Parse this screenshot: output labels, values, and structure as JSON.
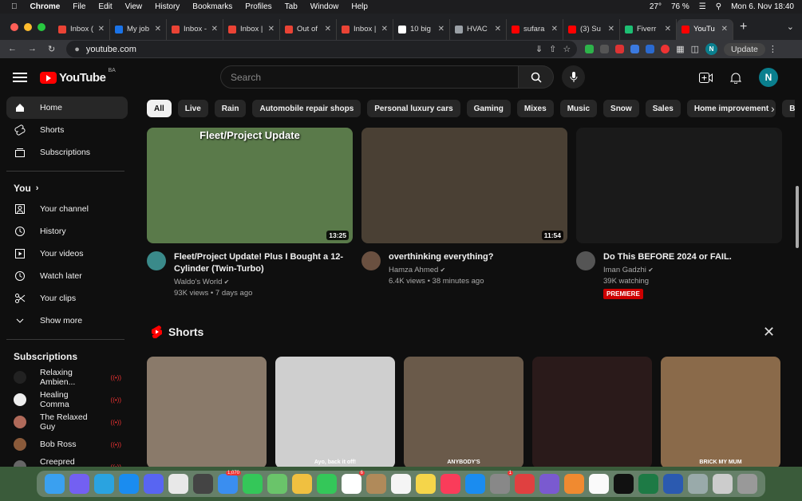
{
  "mac_menubar": {
    "app": "Chrome",
    "menus": [
      "File",
      "Edit",
      "View",
      "History",
      "Bookmarks",
      "Profiles",
      "Tab",
      "Window",
      "Help"
    ],
    "battery": "76 %",
    "temp": "27°",
    "clock": "Mon 6. Nov  18:40"
  },
  "tabs": [
    {
      "title": "Inbox (",
      "color": "#ea4335"
    },
    {
      "title": "My job",
      "color": "#1a73e8"
    },
    {
      "title": "Inbox -",
      "color": "#ea4335"
    },
    {
      "title": "Inbox |",
      "color": "#ea4335"
    },
    {
      "title": "Out of",
      "color": "#ea4335"
    },
    {
      "title": "Inbox |",
      "color": "#ea4335"
    },
    {
      "title": "10 big",
      "color": "#ffffff"
    },
    {
      "title": "HVAC",
      "color": "#9aa0a6"
    },
    {
      "title": "sufara",
      "color": "#ff0000"
    },
    {
      "title": "(3) Su",
      "color": "#ff0000"
    },
    {
      "title": "Fiverr",
      "color": "#1dbf73"
    },
    {
      "title": "YouTu",
      "color": "#ff0000"
    }
  ],
  "omnibox": {
    "url": "youtube.com"
  },
  "toolbar": {
    "update_label": "Update",
    "profile_initial": "N"
  },
  "youtube": {
    "logo_text": "YouTube",
    "country": "BA",
    "search_placeholder": "Search",
    "avatar_initial": "N"
  },
  "sidebar": {
    "main": [
      {
        "label": "Home",
        "icon": "home-icon",
        "active": true
      },
      {
        "label": "Shorts",
        "icon": "shorts-icon"
      },
      {
        "label": "Subscriptions",
        "icon": "subscriptions-icon"
      }
    ],
    "you_heading": "You",
    "you": [
      {
        "label": "Your channel",
        "icon": "channel-icon"
      },
      {
        "label": "History",
        "icon": "history-icon"
      },
      {
        "label": "Your videos",
        "icon": "videos-icon"
      },
      {
        "label": "Watch later",
        "icon": "watch-later-icon"
      },
      {
        "label": "Your clips",
        "icon": "clips-icon"
      },
      {
        "label": "Show more",
        "icon": "chevron-down-icon"
      }
    ],
    "subs_heading": "Subscriptions",
    "subscriptions": [
      {
        "label": "Relaxing Ambien...",
        "color": "#222"
      },
      {
        "label": "Healing Comma",
        "color": "#eee"
      },
      {
        "label": "The Relaxed Guy",
        "color": "#b06a5a"
      },
      {
        "label": "Bob Ross",
        "color": "#8a5a3a"
      },
      {
        "label": "Creepred Produc...",
        "color": "#666"
      }
    ]
  },
  "chips": [
    "All",
    "Live",
    "Rain",
    "Automobile repair shops",
    "Personal luxury cars",
    "Gaming",
    "Mixes",
    "Music",
    "Snow",
    "Sales",
    "Home improvement",
    "Bo"
  ],
  "videos": [
    {
      "title": "Fleet/Project Update! Plus I Bought a 12-Cylinder (Twin-Turbo)",
      "channel": "Waldo's World",
      "stats": "93K views • 7 days ago",
      "duration": "13:25",
      "thumb_text": "Fleet/Project Update",
      "thumb_color": "#5a7a4a",
      "avatar_color": "#3a8a8a"
    },
    {
      "title": "overthinking everything?",
      "channel": "Hamza Ahmed",
      "stats": "6.4K views • 38 minutes ago",
      "duration": "11:54",
      "thumb_color": "#4a4034",
      "avatar_color": "#6a5040"
    },
    {
      "title": "Do This BEFORE 2024 or FAIL.",
      "channel": "Iman Gadzhi",
      "stats": "39K watching",
      "badge": "PREMIERE",
      "thumb_color": "#1a1a1a",
      "avatar_color": "#555"
    }
  ],
  "shorts": {
    "heading": "Shorts",
    "items": [
      {
        "caption": "",
        "color": "#8a7a6a"
      },
      {
        "caption": "Ayo, back it off!",
        "color": "#cfcfcf"
      },
      {
        "caption": "ANYBODY'S",
        "color": "#6a5a4a"
      },
      {
        "caption": "",
        "color": "#2a1a1a"
      },
      {
        "caption": "BRICK MY MUM",
        "color": "#8a6a4a"
      }
    ]
  },
  "dock": [
    {
      "name": "finder-icon",
      "color": "#3aa0f0"
    },
    {
      "name": "viber-icon",
      "color": "#7360f2"
    },
    {
      "name": "telegram-icon",
      "color": "#2aa3e0"
    },
    {
      "name": "safari-icon",
      "color": "#1a8cf0"
    },
    {
      "name": "discord-icon",
      "color": "#5865f2"
    },
    {
      "name": "chrome-icon",
      "color": "#e8e8e8"
    },
    {
      "name": "calculator-icon",
      "color": "#444"
    },
    {
      "name": "mail-icon",
      "color": "#3a8ef0",
      "badge": "1,070"
    },
    {
      "name": "messages-icon",
      "color": "#34c759"
    },
    {
      "name": "maps-icon",
      "color": "#6ac46a"
    },
    {
      "name": "photos-icon",
      "color": "#f0c040"
    },
    {
      "name": "facetime-icon",
      "color": "#34c759"
    },
    {
      "name": "calendar-icon",
      "color": "#ffffff",
      "badge": "6"
    },
    {
      "name": "contacts-icon",
      "color": "#b08a5a"
    },
    {
      "name": "reminders-icon",
      "color": "#f5f5f5"
    },
    {
      "name": "notes-icon",
      "color": "#f5d54a"
    },
    {
      "name": "music-icon",
      "color": "#fa3c5a"
    },
    {
      "name": "app-store-icon",
      "color": "#1a8cf0"
    },
    {
      "name": "system-settings-icon",
      "color": "#888",
      "badge": "1"
    },
    {
      "name": "screencast-icon",
      "color": "#e04040"
    },
    {
      "name": "folder-icon",
      "color": "#7a5ad0"
    },
    {
      "name": "blender-icon",
      "color": "#f08a30"
    },
    {
      "name": "notion-icon",
      "color": "#fafafa"
    },
    {
      "name": "capcut-icon",
      "color": "#111"
    },
    {
      "name": "excel-icon",
      "color": "#1d7a45"
    },
    {
      "name": "word-icon",
      "color": "#2b5ab0"
    },
    {
      "name": "preview-icon",
      "color": "#9aa"
    },
    {
      "name": "downloads-icon",
      "color": "#ccc"
    },
    {
      "name": "trash-icon",
      "color": "#999"
    }
  ]
}
